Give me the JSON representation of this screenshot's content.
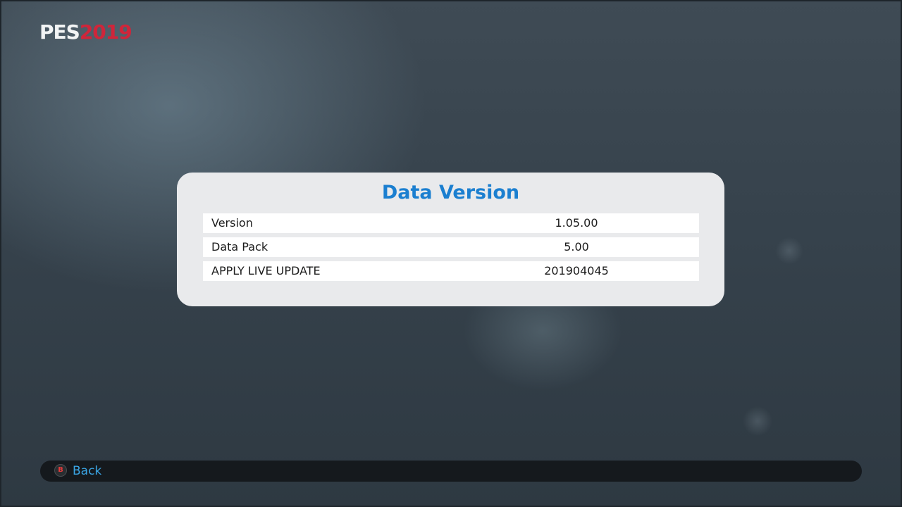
{
  "logo": {
    "brand": "PES",
    "year": "2019"
  },
  "panel": {
    "title": "Data Version",
    "rows": [
      {
        "label": "Version",
        "value": "1.05.00"
      },
      {
        "label": "Data Pack",
        "value": "5.00"
      },
      {
        "label": "APPLY LIVE UPDATE",
        "value": "201904045"
      }
    ]
  },
  "footer": {
    "button_glyph": "B",
    "back_label": "Back"
  },
  "colors": {
    "title_blue": "#1b7fd0",
    "logo_red": "#d0253a",
    "back_blue": "#3aa6e6",
    "b_button_red": "#e23a3a"
  },
  "icons": {
    "back_button": "b-button-icon"
  }
}
